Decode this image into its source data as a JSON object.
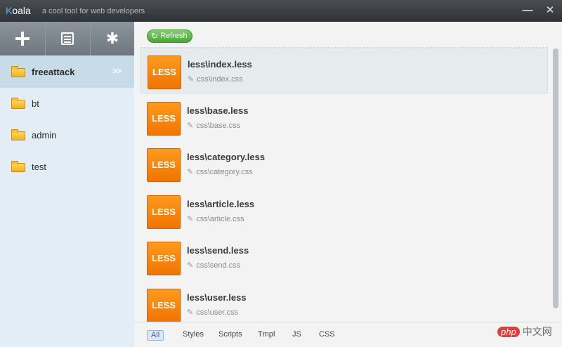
{
  "titlebar": {
    "app_name_first": "K",
    "app_name_rest": "oala",
    "tagline": "a cool tool for web developers",
    "minimize_glyph": "—",
    "close_glyph": "✕"
  },
  "toolbar": {
    "add_icon": "plus-icon",
    "doc_icon": "document-icon",
    "settings_icon": "gear-icon",
    "settings_glyph": "✱"
  },
  "projects": [
    {
      "name": "freeattack",
      "active": true,
      "chevron": ">>"
    },
    {
      "name": "bt"
    },
    {
      "name": "admin"
    },
    {
      "name": "test"
    }
  ],
  "refresh": {
    "label": "Refresh",
    "glyph": "↻"
  },
  "files": [
    {
      "badge": "LESS",
      "source": "less\\index.less",
      "output": "css\\index.css",
      "active": true
    },
    {
      "badge": "LESS",
      "source": "less\\base.less",
      "output": "css\\base.css"
    },
    {
      "badge": "LESS",
      "source": "less\\category.less",
      "output": "css\\category.css"
    },
    {
      "badge": "LESS",
      "source": "less\\article.less",
      "output": "css\\article.css"
    },
    {
      "badge": "LESS",
      "source": "less\\send.less",
      "output": "css\\send.css"
    },
    {
      "badge": "LESS",
      "source": "less\\user.less",
      "output": "css\\user.css"
    }
  ],
  "edit_glyph": "✎",
  "filters": [
    {
      "label": "All",
      "selected": true
    },
    {
      "label": "Styles"
    },
    {
      "label": "Scripts"
    },
    {
      "label": "Tmpl"
    },
    {
      "label": "JS"
    },
    {
      "label": "CSS"
    }
  ],
  "watermark": {
    "php": "php",
    "cn": "中文网"
  },
  "colors": {
    "less_badge": "#f07400",
    "refresh_green": "#4aa636",
    "sidebar_bg": "#e3edf5",
    "active_project": "#c7dbe8"
  }
}
